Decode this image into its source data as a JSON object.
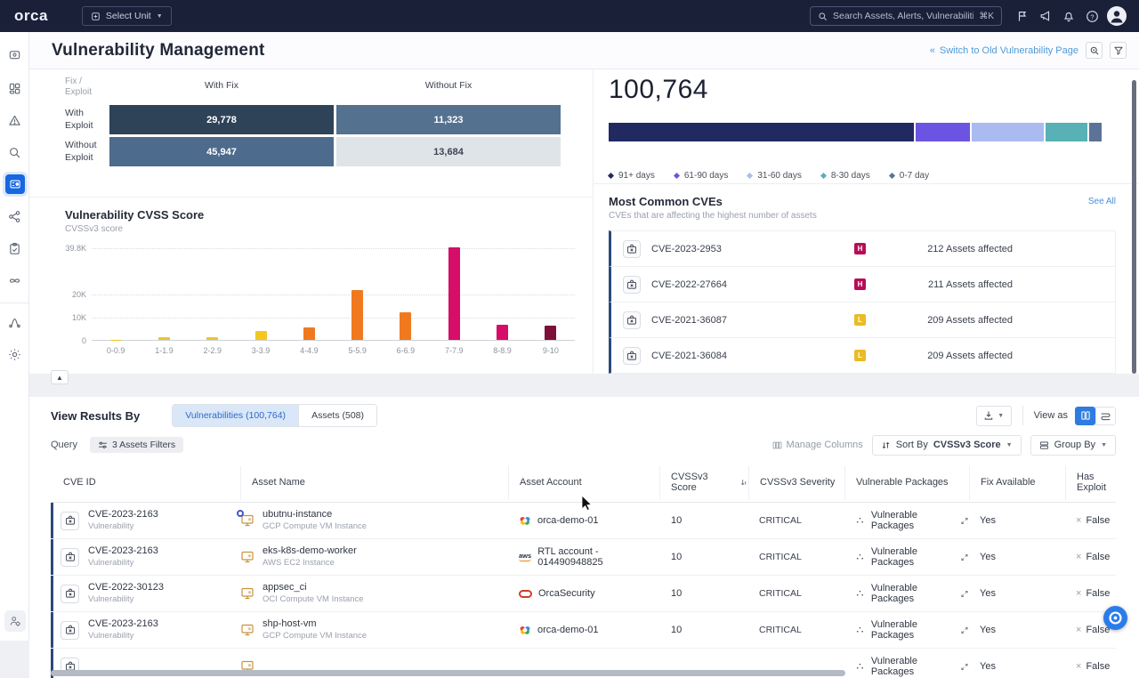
{
  "topbar": {
    "logo_text": "orca",
    "unit_selector_label": "Select Unit",
    "search_placeholder": "Search Assets, Alerts, Vulnerabilities",
    "search_shortcut": "⌘K"
  },
  "page_header": {
    "title": "Vulnerability Management",
    "switch_link_label": "Switch to Old Vulnerability Page"
  },
  "fix_exploit_matrix": {
    "corner_label": "Fix / Exploit",
    "col_headers": [
      "With Fix",
      "Without Fix"
    ],
    "rows": [
      {
        "label": "With Exploit",
        "cells": [
          {
            "value": "29,778",
            "bg": "#2e4258",
            "fg": "#ffffff"
          },
          {
            "value": "11,323",
            "bg": "#54718f",
            "fg": "#ffffff"
          }
        ]
      },
      {
        "label": "Without Exploit",
        "cells": [
          {
            "value": "45,947",
            "bg": "#4d6b8c",
            "fg": "#ffffff"
          },
          {
            "value": "13,684",
            "bg": "#dfe4e9",
            "fg": "#3d4452"
          }
        ]
      }
    ]
  },
  "age_summary": {
    "total": "100,764",
    "segments": [
      {
        "label": "91+ days",
        "color": "#202a60",
        "pct": 61.5
      },
      {
        "label": "61-90 days",
        "color": "#6b54e2",
        "pct": 11.0
      },
      {
        "label": "31-60 days",
        "color": "#aabbf1",
        "pct": 14.5
      },
      {
        "label": "8-30 days",
        "color": "#57b1b5",
        "pct": 8.5
      },
      {
        "label": "0-7 day",
        "color": "#5b7396",
        "pct": 2.5
      }
    ]
  },
  "chart_data": {
    "type": "bar",
    "title": "Vulnerability CVSS Score",
    "subtitle": "CVSSv3 score",
    "categories": [
      "0-0.9",
      "1-1.9",
      "2-2.9",
      "3-3.9",
      "4-4.9",
      "5-5.9",
      "6-6.9",
      "7-7.9",
      "8-8.9",
      "9-10"
    ],
    "values": [
      100,
      1000,
      1000,
      3800,
      5400,
      21500,
      12000,
      39800,
      6500,
      6200
    ],
    "bar_colors": [
      "#edc32d",
      "#edc32d",
      "#edc32d",
      "#f3c71f",
      "#f0791f",
      "#f0791f",
      "#f0791f",
      "#d60e68",
      "#d60e68",
      "#7d1038"
    ],
    "ytick_labels": [
      "0",
      "10K",
      "20K",
      "39.8K"
    ],
    "ytick_values": [
      0,
      10000,
      20000,
      39800
    ],
    "ymax": 39800,
    "xlabel": "",
    "ylabel": "",
    "grid": "dotted-horizontal",
    "legend_position": "none"
  },
  "most_common_cves": {
    "title": "Most Common CVEs",
    "subtitle": "CVEs that are affecting the highest number of assets",
    "see_all_label": "See All",
    "items": [
      {
        "cve": "CVE-2023-2953",
        "severity": "H",
        "severity_color": "#b80d56",
        "assets": "212 Assets affected"
      },
      {
        "cve": "CVE-2022-27664",
        "severity": "H",
        "severity_color": "#b80d56",
        "assets": "211 Assets affected"
      },
      {
        "cve": "CVE-2021-36087",
        "severity": "L",
        "severity_color": "#e9bc26",
        "assets": "209 Assets affected"
      },
      {
        "cve": "CVE-2021-36084",
        "severity": "L",
        "severity_color": "#e9bc26",
        "assets": "209 Assets affected"
      }
    ]
  },
  "results": {
    "view_results_by_label": "View Results By",
    "tabs": [
      {
        "label": "Vulnerabilities (100,764)",
        "active": true
      },
      {
        "label": "Assets (508)",
        "active": false
      }
    ],
    "query_label": "Query",
    "query_chip_label": "3 Assets Filters",
    "view_as_label": "View as",
    "manage_columns_label": "Manage Columns",
    "sort_by_label": "Sort By",
    "sort_by_value": "CVSSv3 Score",
    "group_by_label": "Group By"
  },
  "table": {
    "columns": [
      "CVE ID",
      "Asset Name",
      "Asset Account",
      "CVSSv3 Score",
      "CVSSv3 Severity",
      "Vulnerable Packages",
      "Fix Available",
      "Has Exploit"
    ],
    "rows": [
      {
        "cve": "CVE-2023-2163",
        "cve_type": "Vulnerability",
        "asset": "ubutnu-instance",
        "asset_type": "GCP Compute VM Instance",
        "account": "orca-demo-01",
        "provider": "gcp",
        "badge": true,
        "score": "10",
        "severity": "CRITICAL",
        "packages": "Vulnerable Packages",
        "fix": "Yes",
        "exploit": "False"
      },
      {
        "cve": "CVE-2023-2163",
        "cve_type": "Vulnerability",
        "asset": "eks-k8s-demo-worker",
        "asset_type": "AWS EC2 Instance",
        "account": "RTL account - 014490948825",
        "provider": "aws",
        "badge": false,
        "score": "10",
        "severity": "CRITICAL",
        "packages": "Vulnerable Packages",
        "fix": "Yes",
        "exploit": "False"
      },
      {
        "cve": "CVE-2022-30123",
        "cve_type": "Vulnerability",
        "asset": "appsec_ci",
        "asset_type": "OCI Compute VM Instance",
        "account": "OrcaSecurity",
        "provider": "oracle",
        "badge": false,
        "score": "10",
        "severity": "CRITICAL",
        "packages": "Vulnerable Packages",
        "fix": "Yes",
        "exploit": "False"
      },
      {
        "cve": "CVE-2023-2163",
        "cve_type": "Vulnerability",
        "asset": "shp-host-vm",
        "asset_type": "GCP Compute VM Instance",
        "account": "orca-demo-01",
        "provider": "gcp",
        "badge": false,
        "score": "10",
        "severity": "CRITICAL",
        "packages": "Vulnerable Packages",
        "fix": "Yes",
        "exploit": "False"
      }
    ],
    "partial_row": {
      "packages": "Vulnerable Packages",
      "fix": "Yes",
      "exploit": "False"
    }
  }
}
